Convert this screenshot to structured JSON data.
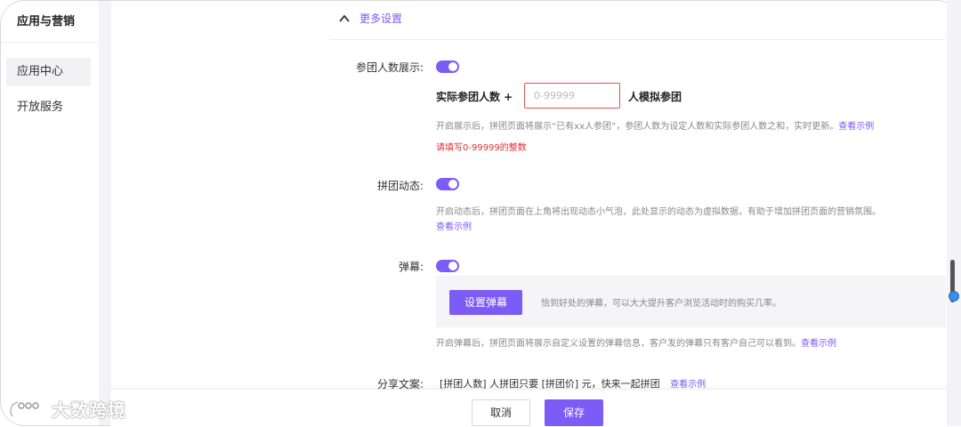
{
  "sidebar": {
    "title": "应用与营销",
    "items": [
      {
        "label": "应用中心",
        "active": true
      },
      {
        "label": "开放服务",
        "active": false
      }
    ]
  },
  "section": {
    "title": "更多设置"
  },
  "participants": {
    "label": "参团人数展示:",
    "enabled": true,
    "prefix": "实际参团人数 +",
    "placeholder": "0-99999",
    "suffix": "人模拟参团",
    "desc": "开启展示后，拼团页面将展示“已有xx人参团”，参团人数为设定人数和实际参团人数之和，实时更新。",
    "example_link": "查看示例",
    "error": "请填写0-99999的整数"
  },
  "dynamics": {
    "label": "拼团动态:",
    "enabled": true,
    "desc": "开启动态后，拼团页面在上角将出现动态小气泡，此处显示的动态为虚拟数据，有助于增加拼团页面的营销氛围。",
    "example_link": "查看示例"
  },
  "danmu": {
    "label": "弹幕:",
    "enabled": true,
    "button": "设置弹幕",
    "hint": "恰到好处的弹幕，可以大大提升客户浏览活动时的购买几率。",
    "desc": "开启弹幕后，拼团页面将展示自定义设置的弹幕信息，客户发的弹幕只有客户自己可以看到。",
    "example_link": "查看示例"
  },
  "share": {
    "label": "分享文案:",
    "text": "[拼团人数] 人拼团只要 [拼团价] 元，快来一起拼团",
    "example_link": "查看示例"
  },
  "footer": {
    "cancel": "取消",
    "save": "保存"
  },
  "watermark": "大数跨境",
  "colors": {
    "accent": "#7b5cf6",
    "error": "#e03030"
  }
}
